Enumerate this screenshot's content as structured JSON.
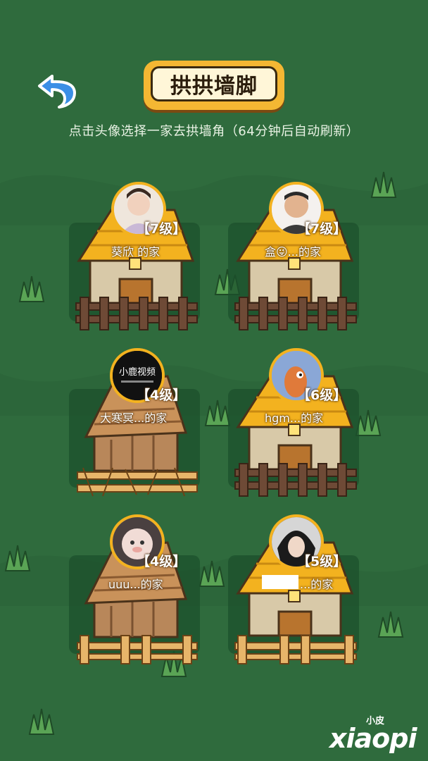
{
  "header": {
    "title": "拱拱墙脚",
    "subtitle": "点击头像选择一家去拱墙角（64分钟后自动刷新）"
  },
  "houses": [
    {
      "name": "葵欣 的家",
      "level": "【7级】",
      "type": "tiled",
      "fence": "brown",
      "avatar": "selfie-photo"
    },
    {
      "name": "盒😜...的家",
      "level": "【7级】",
      "type": "tiled",
      "fence": "brown",
      "avatar": "man-photo"
    },
    {
      "name": "大寒冥...的家",
      "level": "【4级】",
      "type": "wooden",
      "fence": "broken",
      "avatar": "logo-avatar",
      "avatar_text": "小鹿视频"
    },
    {
      "name": "hgm...的家",
      "level": "【6级】",
      "type": "tiled",
      "fence": "brown",
      "avatar": "cartoon-bird"
    },
    {
      "name": "uuu...的家",
      "level": "【4级】",
      "type": "wooden",
      "fence": "light",
      "avatar": "plush-photo"
    },
    {
      "name": "...的家",
      "level": "【5级】",
      "type": "tiled",
      "fence": "light",
      "avatar": "anime-boy"
    }
  ],
  "watermark": {
    "small": "小皮",
    "big": "xiaopi"
  },
  "colors": {
    "background": "#2f6b3d",
    "accent": "#f3b21f"
  },
  "icons": {
    "back": "undo-arrow-icon"
  }
}
